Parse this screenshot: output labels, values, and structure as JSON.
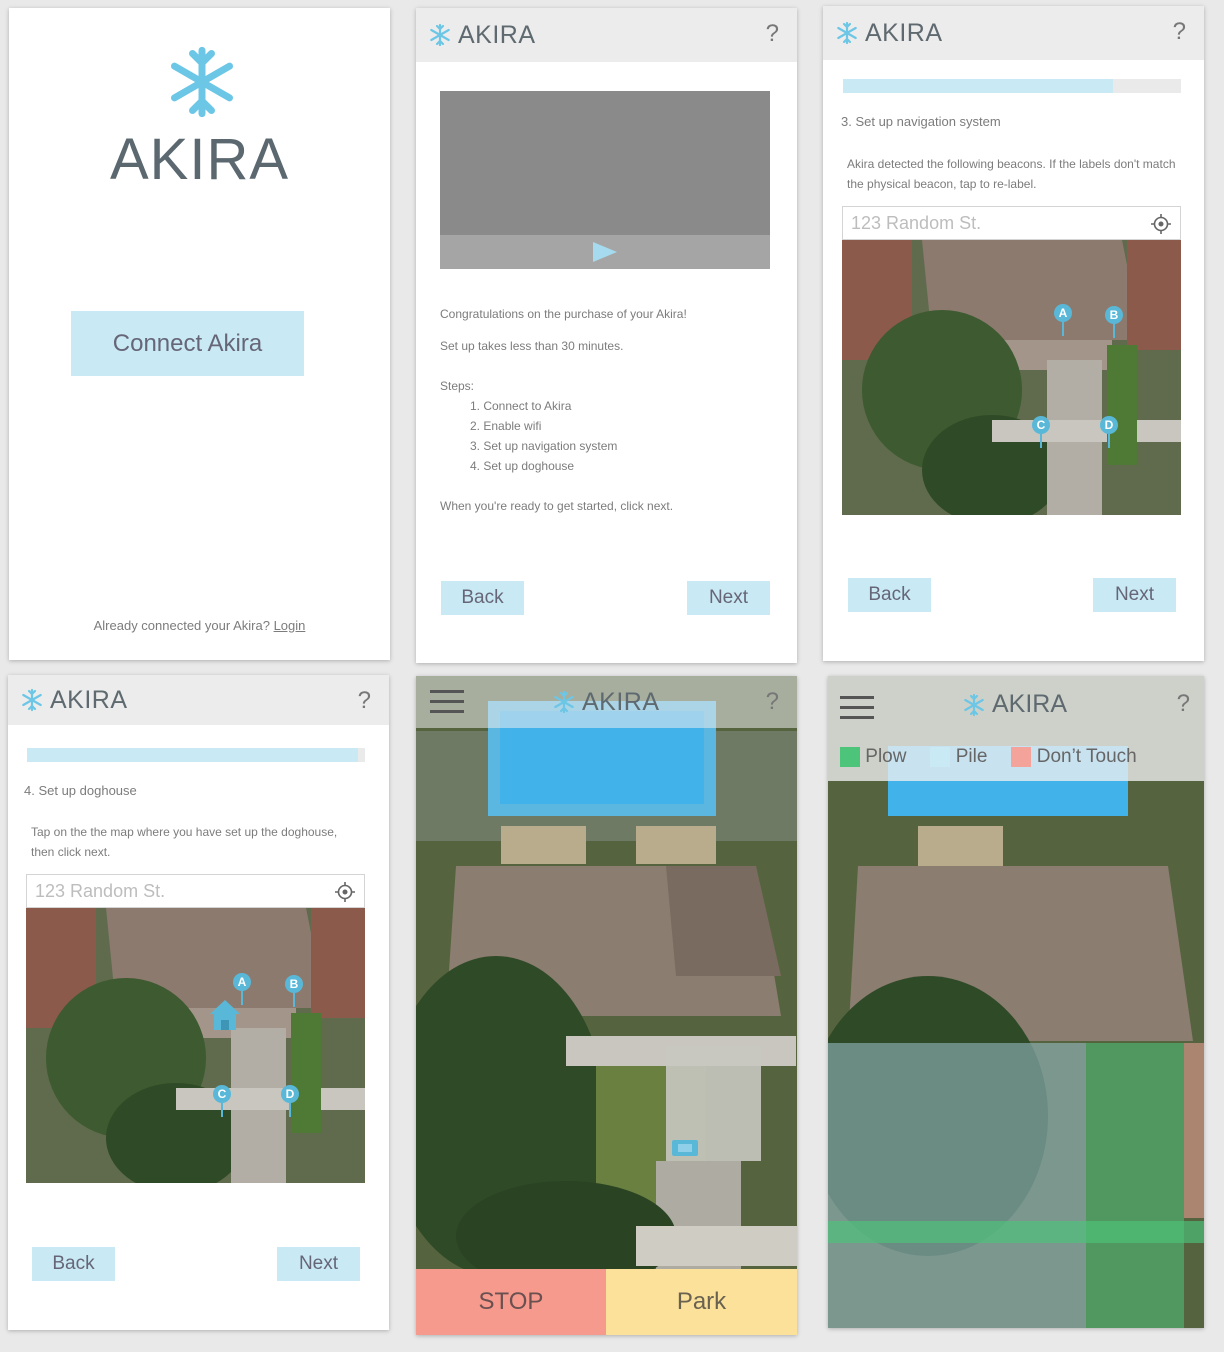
{
  "brand": {
    "name": "AKIRA"
  },
  "screen1": {
    "connect_label": "Connect Akira",
    "already_text": "Already connected your Akira?",
    "login_label": "Login"
  },
  "common": {
    "help": "?",
    "back_label": "Back",
    "next_label": "Next"
  },
  "screen2": {
    "congrats": "Congratulations on the purchase of your Akira!",
    "setup_time": "Set up takes less than 30 minutes.",
    "steps_heading": "Steps:",
    "steps": [
      "1. Connect to Akira",
      "2. Enable wifi",
      "3. Set up navigation system",
      "4. Set up doghouse"
    ],
    "footer": "When you're ready to get started, click next."
  },
  "screen3": {
    "progress": 0.8,
    "heading": "3. Set up navigation system",
    "instructions": "Akira detected the following beacons. If the labels don't match the physical beacon, tap to re-label.",
    "address_placeholder": "123 Random St.",
    "beacons": [
      "A",
      "B",
      "C",
      "D"
    ]
  },
  "screen4": {
    "progress": 0.98,
    "heading": "4. Set up doghouse",
    "instructions": "Tap on the the map where you have set up the doghouse, then click next.",
    "address_placeholder": "123 Random St.",
    "beacons": [
      "A",
      "B",
      "C",
      "D"
    ]
  },
  "screen5": {
    "stop_label": "STOP",
    "park_label": "Park"
  },
  "screen6": {
    "legend": [
      {
        "label": "Plow",
        "color": "#4cc47a"
      },
      {
        "label": "Pile",
        "color": "#c9e9f4"
      },
      {
        "label": "Don’t Touch",
        "color": "#f4a39a"
      }
    ]
  },
  "colors": {
    "accent": "#c9e9f4",
    "icon": "#6cc6e6",
    "stop": "#f59a8c",
    "park": "#fbe19a"
  }
}
